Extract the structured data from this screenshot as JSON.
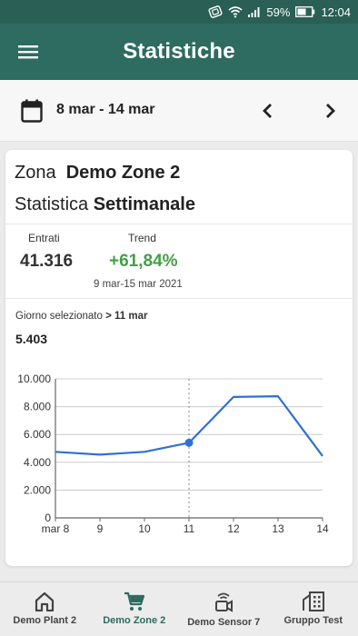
{
  "status": {
    "battery": "59%",
    "time": "12:04"
  },
  "appbar": {
    "title": "Statistiche"
  },
  "datebar": {
    "range": "8 mar - 14 mar"
  },
  "card": {
    "zone_label": "Zona",
    "zone_name": "Demo Zone 2",
    "stat_label": "Statistica",
    "stat_value": "Settimanale",
    "entrati_label": "Entrati",
    "entrati_value": "41.316",
    "trend_label": "Trend",
    "trend_value": "+61,84%",
    "trend_range": "9 mar-15 mar 2021",
    "selected_prefix": "Giorno selezionato",
    "selected_day": "11 mar",
    "selected_value": "5.403"
  },
  "chart_data": {
    "type": "line",
    "x": [
      "mar 8",
      "9",
      "10",
      "11",
      "12",
      "13",
      "14"
    ],
    "values": [
      4750,
      4550,
      4750,
      5403,
      8700,
      8750,
      4450
    ],
    "y_ticks": [
      "0",
      "2.000",
      "4.000",
      "6.000",
      "8.000",
      "10.000"
    ],
    "ylim": [
      0,
      10000
    ],
    "selected_index": 3,
    "grid": true,
    "line_color": "#2f6fd6",
    "grid_color": "#cccccc"
  },
  "bottomnav": {
    "items": [
      {
        "label": "Demo Plant 2",
        "icon": "home-icon"
      },
      {
        "label": "Demo Zone 2",
        "icon": "cart-icon",
        "active": true
      },
      {
        "label": "Demo Sensor 7",
        "icon": "sensor-camera-icon"
      },
      {
        "label": "Gruppo Test",
        "icon": "building-icon"
      }
    ]
  },
  "colors": {
    "primary": "#2e6b60",
    "positive": "#43a047",
    "accent_line": "#2f6fd6"
  }
}
